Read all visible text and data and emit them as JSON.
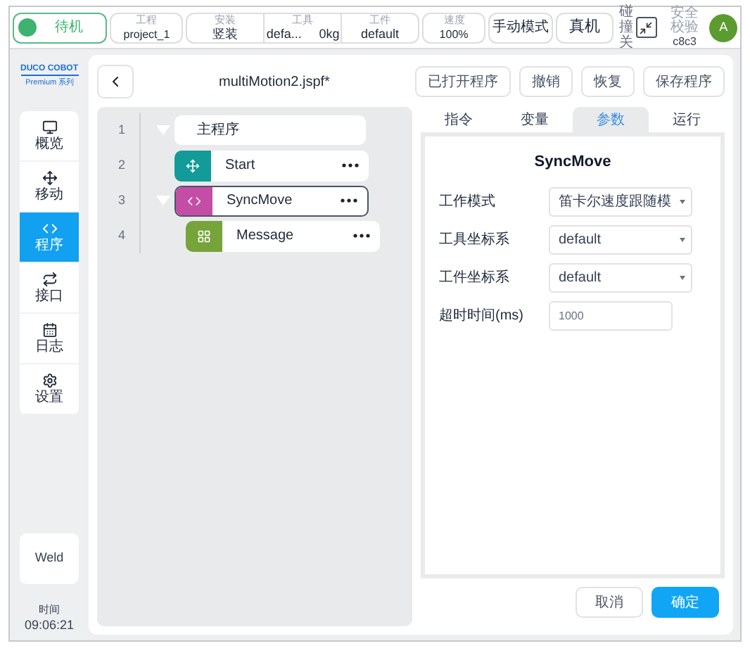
{
  "top_bar": {
    "status": {
      "label": "待机",
      "running": false
    },
    "project": {
      "label": "工程",
      "value": "project_1"
    },
    "install": [
      {
        "label": "安装",
        "values": [
          "竖装"
        ]
      },
      {
        "label": "工具",
        "values": [
          "defa...",
          "0kg"
        ]
      },
      {
        "label": "工件",
        "values": [
          "default"
        ]
      }
    ],
    "speed": {
      "label": "速度",
      "value": "100%"
    },
    "mode_buttons": [
      "手动模式",
      "真机"
    ],
    "collision": "碰撞关",
    "safety": {
      "label": "安全校验",
      "value": "c8c3"
    },
    "avatar": "A"
  },
  "sidebar": {
    "logo": {
      "name": "DUCO COBOT",
      "series": "Premium 系列"
    },
    "items": [
      {
        "label": "概览",
        "kind": "monitor",
        "selected": false
      },
      {
        "label": "移动",
        "kind": "move",
        "selected": false
      },
      {
        "label": "程序",
        "kind": "code",
        "selected": true
      },
      {
        "label": "接口",
        "kind": "repeat",
        "selected": false
      },
      {
        "label": "日志",
        "kind": "calendar",
        "selected": false
      },
      {
        "label": "设置",
        "kind": "gear",
        "selected": false
      }
    ],
    "weld": "Weld",
    "time": {
      "label": "时间",
      "value": "09:06:21"
    }
  },
  "header": {
    "title": "multiMotion2.jspf*",
    "buttons": [
      "已打开程序",
      "撤销",
      "恢复",
      "保存程序"
    ]
  },
  "program_tree": [
    {
      "number": "1",
      "label": "主程序",
      "kind": "root",
      "expanded": true,
      "selected": false,
      "children": [
        {
          "number": "2",
          "label": "Start",
          "kind": "move",
          "selected": false
        },
        {
          "number": "3",
          "label": "SyncMove",
          "kind": "code",
          "expanded": true,
          "selected": true,
          "children": [
            {
              "number": "4",
              "label": "Message",
              "kind": "grid",
              "selected": false
            }
          ]
        }
      ]
    }
  ],
  "tabs": [
    {
      "label": "指令",
      "selected": false
    },
    {
      "label": "变量",
      "selected": false
    },
    {
      "label": "参数",
      "selected": true
    },
    {
      "label": "运行",
      "selected": false
    }
  ],
  "params": {
    "title": "SyncMove",
    "fields": [
      {
        "label": "工作模式",
        "kind": "select",
        "value": "笛卡尔速度跟随模"
      },
      {
        "label": "工具坐标系",
        "kind": "select",
        "value": "default"
      },
      {
        "label": "工件坐标系",
        "kind": "select",
        "value": "default"
      },
      {
        "label": "超时时间(ms)",
        "kind": "input",
        "value": "1000"
      }
    ]
  },
  "footer_buttons": [
    {
      "label": "取消",
      "primary": false
    },
    {
      "label": "确定",
      "primary": true
    }
  ]
}
